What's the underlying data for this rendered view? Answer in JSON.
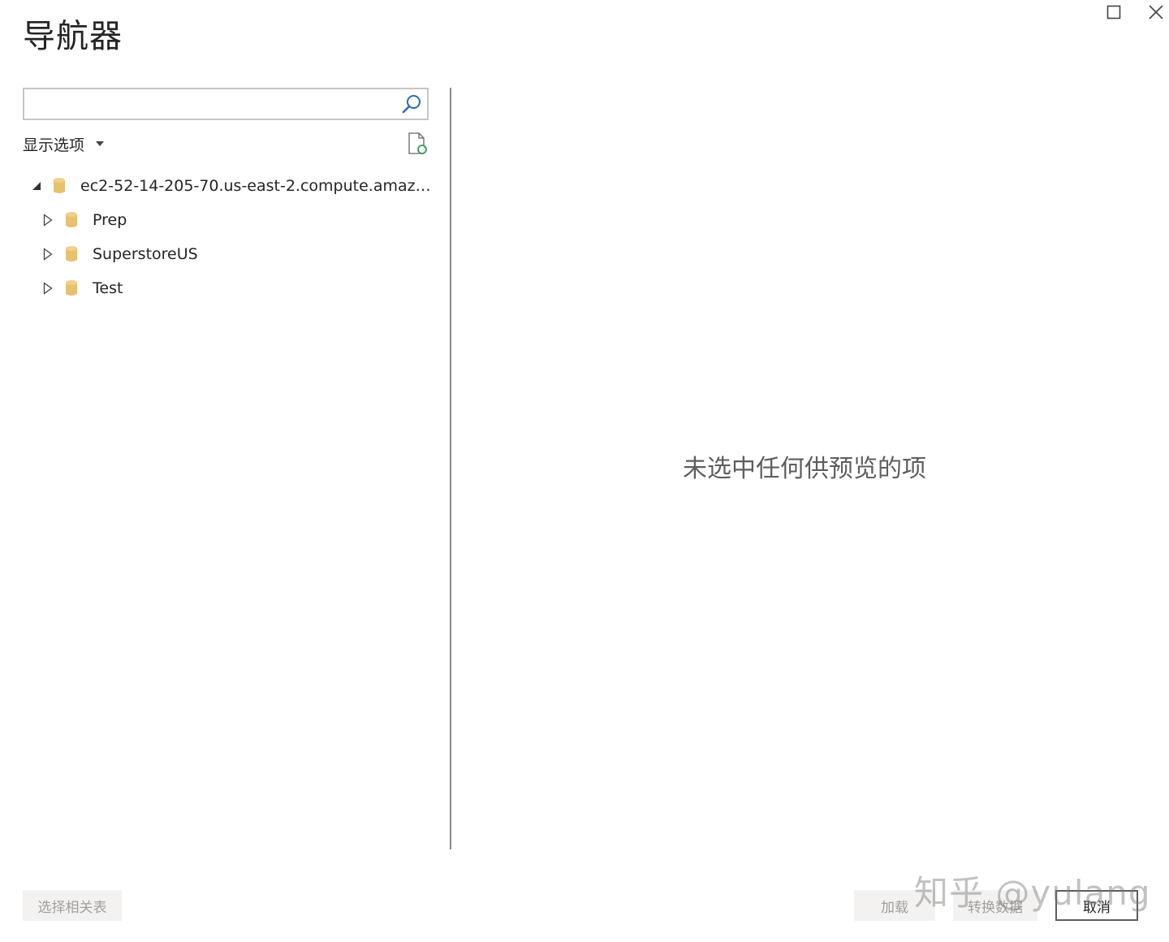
{
  "window": {
    "title": "导航器"
  },
  "search": {
    "value": "",
    "placeholder": ""
  },
  "toolbar": {
    "display_options_label": "显示选项"
  },
  "tree": {
    "root": {
      "label": "ec2-52-14-205-70.us-east-2.compute.amazona...",
      "expanded": true
    },
    "children": [
      {
        "label": "Prep",
        "expanded": false
      },
      {
        "label": "SuperstoreUS",
        "expanded": false
      },
      {
        "label": "Test",
        "expanded": false
      }
    ]
  },
  "preview": {
    "empty_message": "未选中任何供预览的项"
  },
  "footer": {
    "select_related_label": "选择相关表",
    "load_label": "加载",
    "transform_label": "转换数据",
    "cancel_label": "取消"
  },
  "watermark": {
    "text": "知乎 @yulang"
  },
  "colors": {
    "db_icon": "#e8c170",
    "divider": "#8a8886",
    "search_icon": "#2b6cb0",
    "refresh_accent": "#3a9a5b"
  },
  "icons": {
    "maximize": "maximize-icon",
    "close": "close-icon",
    "search": "search-icon",
    "refresh": "refresh-document-icon",
    "database": "database-icon",
    "expanded": "triangle-expanded-icon",
    "collapsed": "triangle-collapsed-icon"
  }
}
